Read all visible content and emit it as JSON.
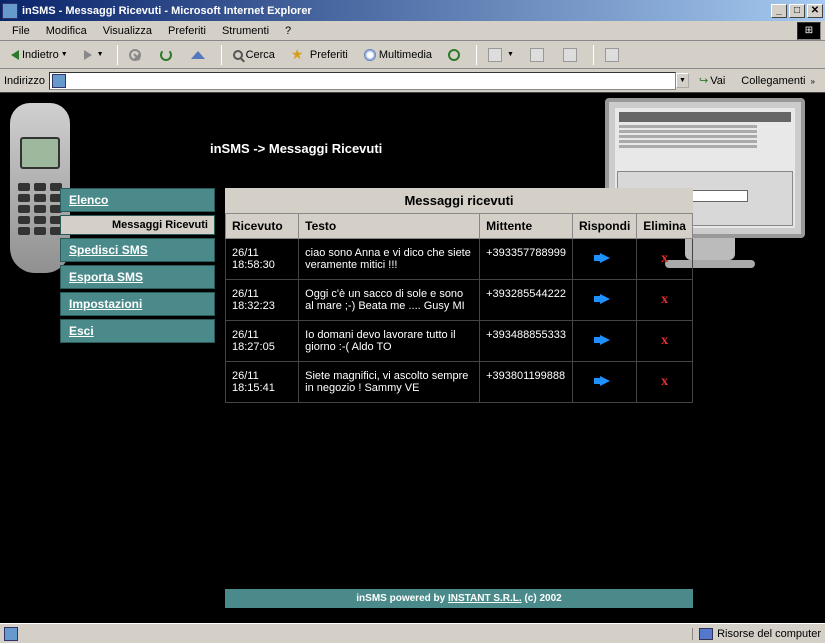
{
  "window": {
    "title": "inSMS - Messaggi Ricevuti - Microsoft Internet Explorer"
  },
  "menubar": {
    "items": [
      "File",
      "Modifica",
      "Visualizza",
      "Preferiti",
      "Strumenti",
      "?"
    ]
  },
  "toolbar": {
    "back": "Indietro",
    "search": "Cerca",
    "favorites": "Preferiti",
    "multimedia": "Multimedia"
  },
  "addressbar": {
    "label": "Indirizzo",
    "url": "",
    "go": "Vai",
    "links": "Collegamenti"
  },
  "breadcrumb": "inSMS -> Messaggi Ricevuti",
  "sidenav": {
    "items": [
      {
        "label": "Elenco",
        "active": false
      },
      {
        "label": "Messaggi Ricevuti",
        "active": true
      },
      {
        "label": "Spedisci SMS",
        "active": false
      },
      {
        "label": "Esporta SMS",
        "active": false
      },
      {
        "label": "Impostazioni",
        "active": false
      },
      {
        "label": "Esci",
        "active": false
      }
    ]
  },
  "table": {
    "title": "Messaggi ricevuti",
    "headers": {
      "received": "Ricevuto",
      "text": "Testo",
      "sender": "Mittente",
      "reply": "Rispondi",
      "delete": "Elimina"
    },
    "rows": [
      {
        "received": "26/11 18:58:30",
        "text": "ciao sono Anna e vi dico che siete veramente mitici !!!",
        "sender": "+393357788999"
      },
      {
        "received": "26/11 18:32:23",
        "text": "Oggi c'è un sacco di sole e sono al mare ;-) Beata me .... Gusy MI",
        "sender": "+393285544222"
      },
      {
        "received": "26/11 18:27:05",
        "text": "Io domani devo lavorare tutto il giorno :-( Aldo TO",
        "sender": "+393488855333"
      },
      {
        "received": "26/11 18:15:41",
        "text": "Siete magnifici, vi ascolto sempre in negozio ! Sammy VE",
        "sender": "+393801199888"
      }
    ]
  },
  "footer": {
    "prefix": "inSMS powered by ",
    "link": "INSTANT S.R.L.",
    "suffix": " (c) 2002"
  },
  "statusbar": {
    "zone": "Risorse del computer"
  }
}
